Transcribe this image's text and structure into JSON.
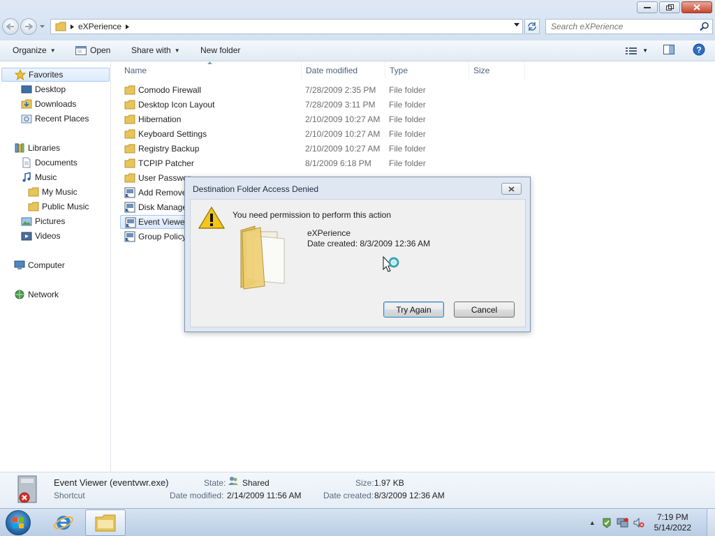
{
  "window": {
    "breadcrumb": [
      "eXPerience"
    ],
    "search_placeholder": "Search eXPerience"
  },
  "toolbar": {
    "organize": "Organize",
    "open": "Open",
    "share_with": "Share with",
    "new_folder": "New folder"
  },
  "navpane": {
    "favorites": "Favorites",
    "desktop": "Desktop",
    "downloads": "Downloads",
    "recent_places": "Recent Places",
    "libraries": "Libraries",
    "documents": "Documents",
    "music": "Music",
    "my_music": "My Music",
    "public_music": "Public Music",
    "pictures": "Pictures",
    "videos": "Videos",
    "computer": "Computer",
    "network": "Network"
  },
  "columns": {
    "name": "Name",
    "date_modified": "Date modified",
    "type": "Type",
    "size": "Size"
  },
  "files": [
    {
      "name": "Comodo Firewall",
      "date": "7/28/2009 2:35 PM",
      "type": "File folder"
    },
    {
      "name": "Desktop Icon Layout",
      "date": "7/28/2009 3:11 PM",
      "type": "File folder"
    },
    {
      "name": "Hibernation",
      "date": "2/10/2009 10:27 AM",
      "type": "File folder"
    },
    {
      "name": "Keyboard Settings",
      "date": "2/10/2009 10:27 AM",
      "type": "File folder"
    },
    {
      "name": "Registry Backup",
      "date": "2/10/2009 10:27 AM",
      "type": "File folder"
    },
    {
      "name": "TCPIP Patcher",
      "date": "8/1/2009 6:18 PM",
      "type": "File folder"
    },
    {
      "name": "User Passwor",
      "date": "",
      "type": ""
    },
    {
      "name": "Add Remove",
      "date": "",
      "type": ""
    },
    {
      "name": "Disk Manage",
      "date": "",
      "type": ""
    },
    {
      "name": "Event Viewe",
      "date": "",
      "type": ""
    },
    {
      "name": "Group Policy",
      "date": "",
      "type": ""
    }
  ],
  "details": {
    "name": "Event Viewer (eventvwr.exe)",
    "kind": "Shortcut",
    "state_label": "State:",
    "state_value": "Shared",
    "size_label": "Size:",
    "size_value": "1.97 KB",
    "modified_label": "Date modified:",
    "modified_value": "2/14/2009 11:56 AM",
    "created_label": "Date created:",
    "created_value": "8/3/2009 12:36 AM"
  },
  "dialog": {
    "title": "Destination Folder Access Denied",
    "message": "You need permission to perform this action",
    "folder_name": "eXPerience",
    "folder_created": "Date created: 8/3/2009 12:36 AM",
    "try_again": "Try Again",
    "cancel": "Cancel"
  },
  "taskbar": {
    "time": "7:19 PM",
    "date": "5/14/2022"
  },
  "colors": {
    "accent": "#1c5f9f",
    "selection": "#d9e8fb",
    "folder": "#e8c55a"
  }
}
